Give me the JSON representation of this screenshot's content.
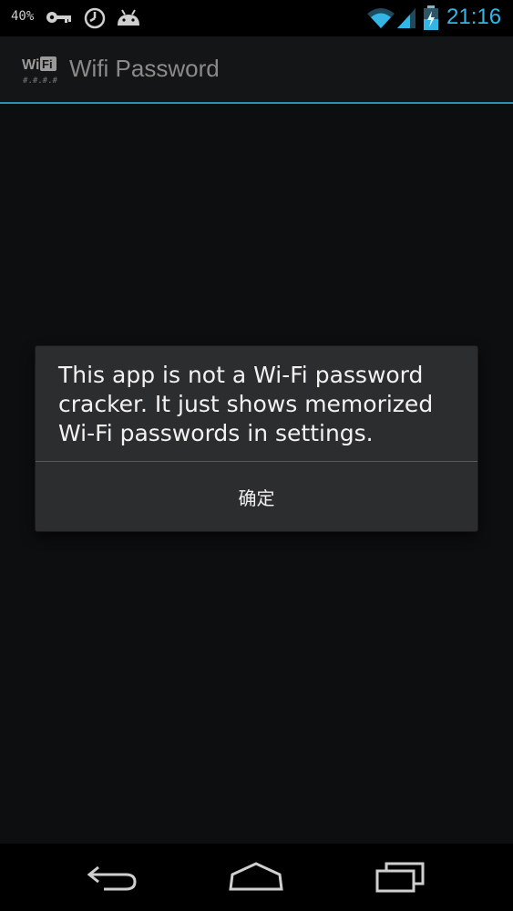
{
  "status_bar": {
    "battery_percent": "40%",
    "time": "21:16",
    "icons": [
      "key-icon",
      "clock-icon",
      "android-icon",
      "wifi-icon",
      "signal-icon",
      "battery-charging-icon"
    ]
  },
  "action_bar": {
    "app_icon_label": "WiFi",
    "title": "Wifi Password"
  },
  "dialog": {
    "message": "This app is not a Wi-Fi password cracker. It just shows memorized Wi-Fi passwords in settings.",
    "ok_button": "确定"
  },
  "nav_bar": {
    "buttons": [
      "back-icon",
      "home-icon",
      "recent-apps-icon"
    ]
  },
  "colors": {
    "accent": "#33b5e5",
    "divider": "#2a8fb1",
    "dialog_bg": "#2c2d2e"
  }
}
